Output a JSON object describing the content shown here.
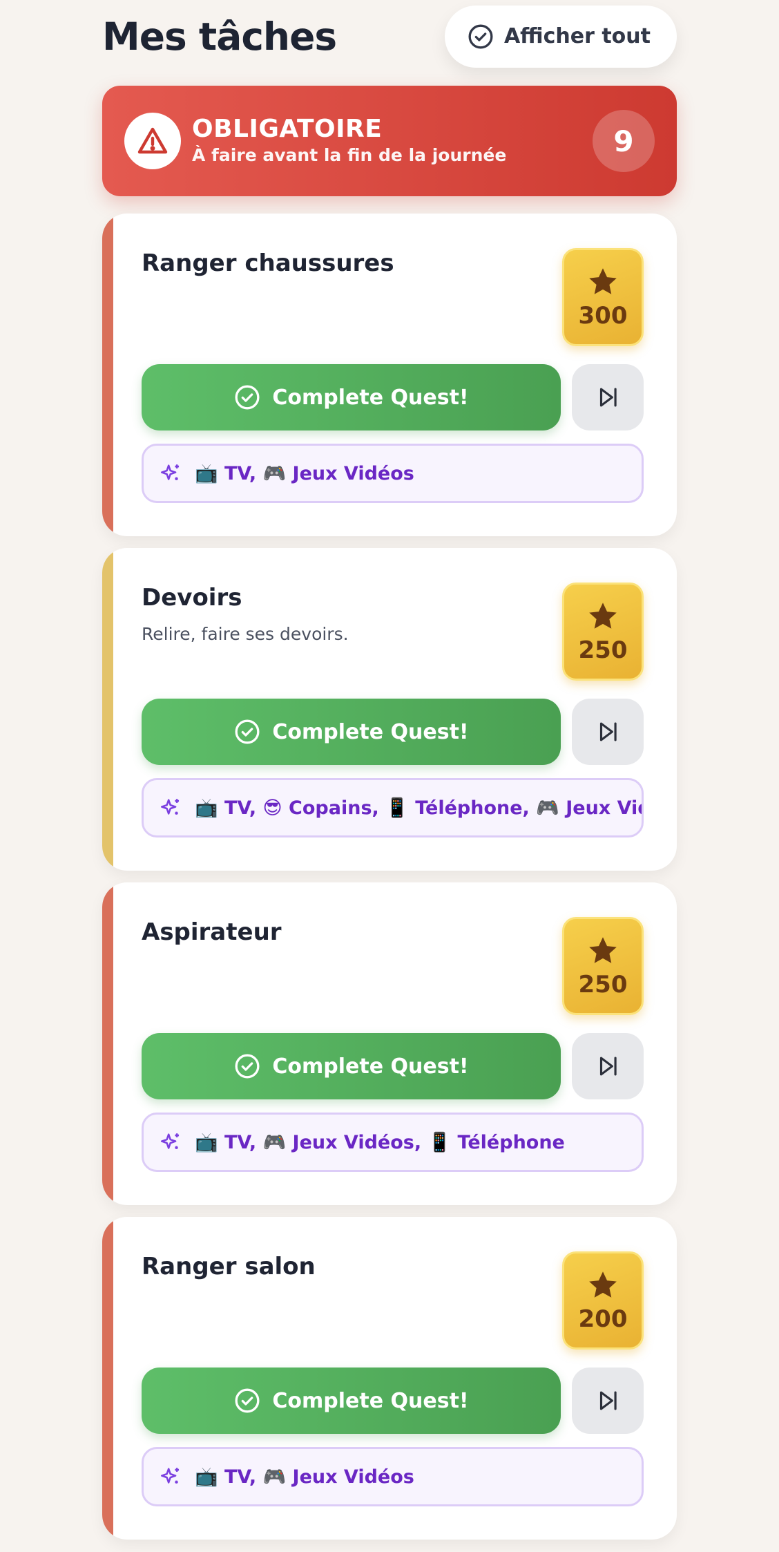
{
  "header": {
    "title": "Mes tâches",
    "show_all_label": "Afficher tout"
  },
  "mandatory": {
    "title": "OBLIGATOIRE",
    "subtitle": "À faire avant la fin de la journée",
    "count": "9"
  },
  "colors": {
    "mandatory_accent": "#d9705a",
    "homework_accent": "#e3c36a",
    "complete_green": "#5ebe69",
    "points_gold": "#f6cf4b",
    "reward_purple": "#6a27c4"
  },
  "tasks": [
    {
      "title": "Ranger chaussures",
      "description": "",
      "points": "300",
      "complete_label": "Complete Quest!",
      "rewards": "📺 TV, 🎮 Jeux Vidéos"
    },
    {
      "title": "Devoirs",
      "description": "Relire, faire ses devoirs.",
      "points": "250",
      "complete_label": "Complete Quest!",
      "rewards": "📺 TV, 😎 Copains, 📱 Téléphone, 🎮 Jeux Vidéos"
    },
    {
      "title": "Aspirateur",
      "description": "",
      "points": "250",
      "complete_label": "Complete Quest!",
      "rewards": "📺 TV, 🎮 Jeux Vidéos, 📱 Téléphone"
    },
    {
      "title": "Ranger salon",
      "description": "",
      "points": "200",
      "complete_label": "Complete Quest!",
      "rewards": "📺 TV, 🎮 Jeux Vidéos"
    }
  ]
}
